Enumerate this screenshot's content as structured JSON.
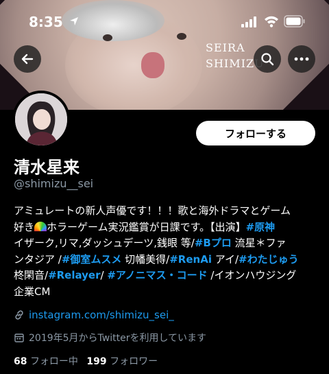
{
  "status_bar": {
    "time": "8:35"
  },
  "banner": {
    "text_line1": "SEIRA",
    "text_line2": "SHIMIZU"
  },
  "profile": {
    "display_name": "清水星来",
    "handle": "@shimizu__sei",
    "follow_label": "フォローする"
  },
  "bio": {
    "l1": "アミュレートの新人声優です！！！歌と海外ドラマとゲーム",
    "l2a": "好き",
    "l2b": "ホラーゲーム実況鑑賞が日課です。【出演】",
    "l2tag": "#原神",
    "l3a": "イザーク,リマ,ダッシュデーツ,銭眼 等/",
    "l3tag": "#Bプロ",
    "l3b": " 流星＊ファ",
    "l4a": "ンタジア /",
    "l4tag1": "#御室ムスメ",
    "l4b": " 切幡美得/",
    "l4tag2": "#RenAi",
    "l4c": " アイ/",
    "l4tag3": "#わたじゅう",
    "l5a": "柊閑音/",
    "l5tag1": "#Relayer",
    "l5b": "/ ",
    "l5tag2": "#アノニマス・コード",
    "l5c": " /イオンハウジング",
    "l6": "企業CM"
  },
  "link": {
    "text": "instagram.com/shimizu_sei_"
  },
  "joined": {
    "text": "2019年5月からTwitterを利用しています"
  },
  "stats": {
    "following_count": "68",
    "following_label": "フォロー中",
    "followers_count": "199",
    "followers_label": "フォロワー"
  },
  "icons": [
    "back-arrow-icon",
    "search-icon",
    "more-icon",
    "link-icon",
    "calendar-icon",
    "location-arrow-icon",
    "signal-icon",
    "wifi-icon",
    "battery-icon",
    "rainbow-emoji"
  ]
}
